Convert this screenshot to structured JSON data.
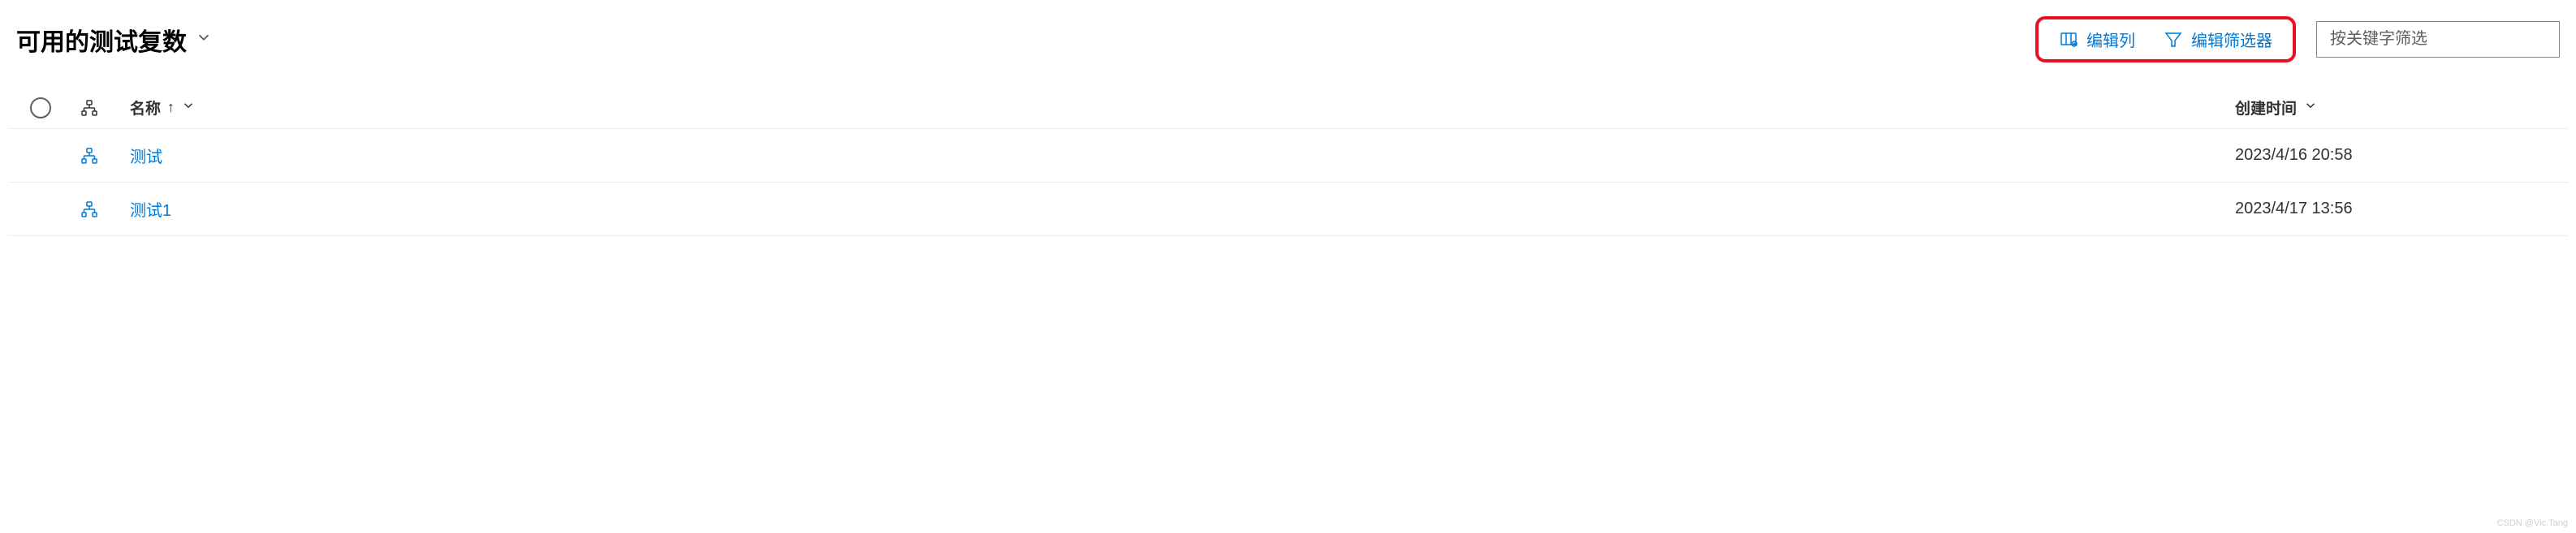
{
  "header": {
    "title": "可用的测试复数"
  },
  "toolbar": {
    "edit_columns": "编辑列",
    "edit_filters": "编辑筛选器",
    "search_placeholder": "按关键字筛选"
  },
  "table": {
    "columns": {
      "name": "名称",
      "created": "创建时间"
    },
    "rows": [
      {
        "name": "测试",
        "created": "2023/4/16 20:58"
      },
      {
        "name": "测试1",
        "created": "2023/4/17 13:56"
      }
    ]
  },
  "watermark": "CSDN @Vic.Tang"
}
